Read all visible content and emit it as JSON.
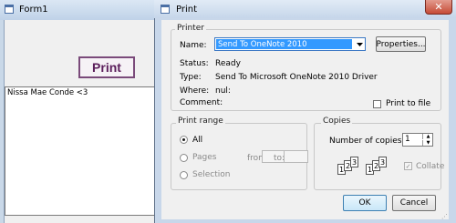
{
  "form1": {
    "title": "Form1",
    "print_button_label": "Print",
    "textbox_value": "Nissa Mae Conde <3"
  },
  "print_dialog": {
    "title": "Print",
    "close_glyph": "✕",
    "printer_group": {
      "label": "Printer",
      "name_label": "Name:",
      "selected_printer": "Send To OneNote 2010",
      "properties_label": "Properties...",
      "status_label": "Status:",
      "status_value": "Ready",
      "type_label": "Type:",
      "type_value": "Send To Microsoft OneNote 2010 Driver",
      "where_label": "Where:",
      "where_value": "nul:",
      "comment_label": "Comment:",
      "print_to_file_label": "Print to file",
      "print_to_file_checked": false
    },
    "print_range": {
      "label": "Print range",
      "all_label": "All",
      "pages_label": "Pages",
      "from_label": "from:",
      "to_label": "to:",
      "selection_label": "Selection",
      "selected": "All"
    },
    "copies": {
      "label": "Copies",
      "number_label": "Number of copies:",
      "number_value": "1",
      "collate_label": "Collate",
      "collate_checked": true,
      "collate_enabled": false,
      "page_glyphs": [
        "1",
        "2",
        "3",
        "1",
        "2",
        "3"
      ]
    },
    "ok_label": "OK",
    "cancel_label": "Cancel"
  },
  "colors": {
    "selection_highlight": "#3399ff",
    "print_button_text": "#5b1e5b",
    "close_button": "#c64b36",
    "disabled_text": "#8a8a8a"
  },
  "icons": [
    "window-icon",
    "dropdown-arrow-icon",
    "close-icon",
    "spin-up-icon",
    "spin-down-icon",
    "resize-grip-icon"
  ]
}
